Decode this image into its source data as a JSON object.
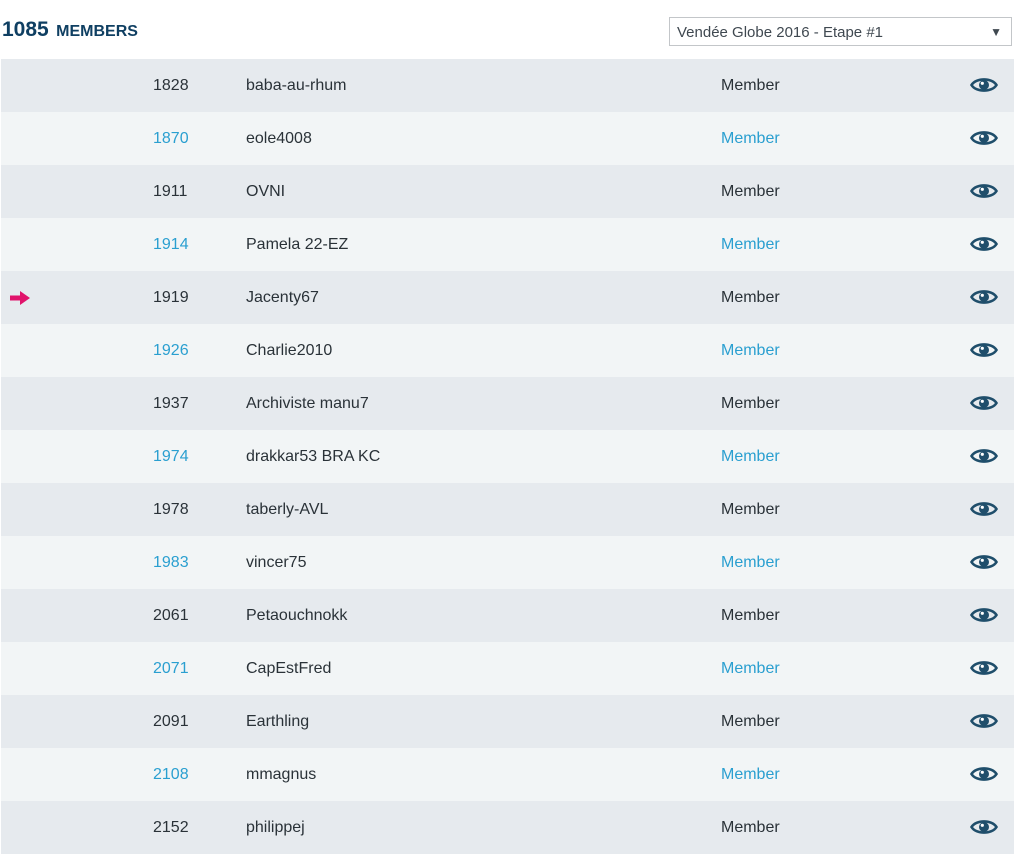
{
  "header": {
    "count": "1085",
    "count_label": "MEMBERS",
    "race_select": {
      "selected": "Vendée Globe 2016 - Etape #1",
      "arrow": "▼"
    }
  },
  "colors": {
    "header_text": "#0f3f62",
    "link_blue": "#2a9fd0",
    "row_dark": "#e6eaee",
    "row_light": "#f2f5f6",
    "eye_icon": "#1f4e6b",
    "highlight_arrow": "#e0136b"
  },
  "members": [
    {
      "rank": "1828",
      "name": "baba-au-rhum",
      "role": "Member",
      "highlighted": false
    },
    {
      "rank": "1870",
      "name": "eole4008",
      "role": "Member",
      "highlighted": false
    },
    {
      "rank": "1911",
      "name": "OVNI",
      "role": "Member",
      "highlighted": false
    },
    {
      "rank": "1914",
      "name": "Pamela 22-EZ",
      "role": "Member",
      "highlighted": false
    },
    {
      "rank": "1919",
      "name": "Jacenty67",
      "role": "Member",
      "highlighted": true
    },
    {
      "rank": "1926",
      "name": "Charlie2010",
      "role": "Member",
      "highlighted": false
    },
    {
      "rank": "1937",
      "name": "Archiviste manu7",
      "role": "Member",
      "highlighted": false
    },
    {
      "rank": "1974",
      "name": "drakkar53 BRA KC",
      "role": "Member",
      "highlighted": false
    },
    {
      "rank": "1978",
      "name": "taberly-AVL",
      "role": "Member",
      "highlighted": false
    },
    {
      "rank": "1983",
      "name": "vincer75",
      "role": "Member",
      "highlighted": false
    },
    {
      "rank": "2061",
      "name": "Petaouchnokk",
      "role": "Member",
      "highlighted": false
    },
    {
      "rank": "2071",
      "name": "CapEstFred",
      "role": "Member",
      "highlighted": false
    },
    {
      "rank": "2091",
      "name": "Earthling",
      "role": "Member",
      "highlighted": false
    },
    {
      "rank": "2108",
      "name": "mmagnus",
      "role": "Member",
      "highlighted": false
    },
    {
      "rank": "2152",
      "name": "philippej",
      "role": "Member",
      "highlighted": false
    }
  ],
  "icons": {
    "row_action": "eye-icon",
    "current_user_marker": "arrow-right-icon"
  }
}
